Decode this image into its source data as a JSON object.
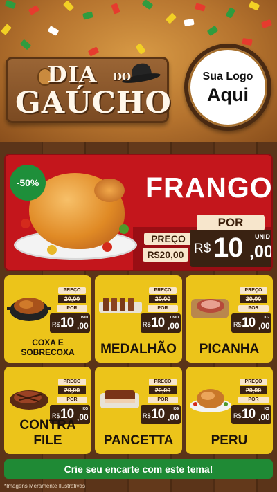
{
  "header": {
    "title_line1": "DIA",
    "title_do": "DO",
    "title_line2": "GAÚCHO",
    "logo_line1": "Sua Logo",
    "logo_line2": "Aqui"
  },
  "featured": {
    "discount": "-50%",
    "name": "FRANGO",
    "preco_label": "PREÇO",
    "old_price": "R$20,00",
    "por_label": "POR",
    "currency": "R$",
    "price_int": "10",
    "price_dec": ",00",
    "unit": "UNID"
  },
  "products": [
    {
      "name": "COXA E SOBRECOXA",
      "preco_label": "PREÇO",
      "old_price": "20,00",
      "por_label": "POR",
      "currency": "R$",
      "price_int": "10",
      "price_dec": ",00",
      "unit": "UNID"
    },
    {
      "name": "MEDALHÃO",
      "preco_label": "PREÇO",
      "old_price": "20,00",
      "por_label": "POR",
      "currency": "R$",
      "price_int": "10",
      "price_dec": ",00",
      "unit": "UNID"
    },
    {
      "name": "PICANHA",
      "preco_label": "PREÇO",
      "old_price": "20,00",
      "por_label": "POR",
      "currency": "R$",
      "price_int": "10",
      "price_dec": ",00",
      "unit": "KG"
    },
    {
      "name": "CONTRA FILE",
      "preco_label": "PREÇO",
      "old_price": "20,00",
      "por_label": "POR",
      "currency": "R$",
      "price_int": "10",
      "price_dec": ",00",
      "unit": "KG"
    },
    {
      "name": "PANCETTA",
      "preco_label": "PREÇO",
      "old_price": "20,00",
      "por_label": "POR",
      "currency": "R$",
      "price_int": "10",
      "price_dec": ",00",
      "unit": "KG"
    },
    {
      "name": "PERU",
      "preco_label": "PREÇO",
      "old_price": "20,00",
      "por_label": "POR",
      "currency": "R$",
      "price_int": "10",
      "price_dec": ",00",
      "unit": "KG"
    }
  ],
  "cta": "Crie seu encarte com este tema!",
  "disclaimer": "*Imagens Meramente Ilustrativas",
  "colors": {
    "featured_bg": "#c4161c",
    "card_bg": "#ecc41a",
    "cta_bg": "#1f8a35",
    "price_box": "#3a2212"
  }
}
